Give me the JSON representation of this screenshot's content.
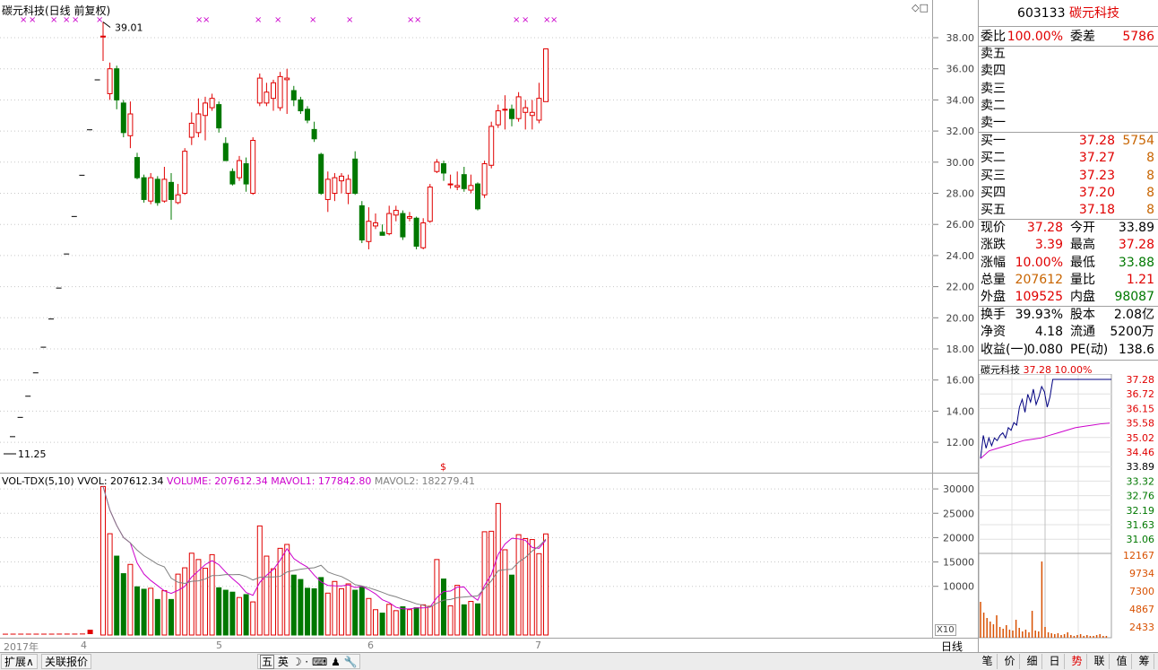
{
  "chart": {
    "title": "碳元科技(日线 前复权)"
  },
  "price_axis": [
    "38.00",
    "36.00",
    "34.00",
    "32.00",
    "30.00",
    "28.00",
    "26.00",
    "24.00",
    "22.00",
    "20.00",
    "18.00",
    "16.00",
    "14.00",
    "12.00"
  ],
  "price_annotations": {
    "high": "39.01",
    "low": "11.25"
  },
  "volume": {
    "indicator": "VOL-TDX(5,10)",
    "vvol": "VVOL: 207612.34",
    "volume": "VOLUME: 207612.34",
    "mavol1": "MAVOL1: 177842.80",
    "mavol2": "MAVOL2: 182279.41",
    "scale_label": "X10",
    "axis": [
      "30000",
      "25000",
      "20000",
      "15000",
      "10000"
    ]
  },
  "time_axis": [
    "2017年",
    "4",
    "5",
    "6",
    "7",
    "日线"
  ],
  "quote": {
    "code": "603133",
    "name": "碳元科技",
    "entrust": [
      "委比",
      "100.00%",
      "委差",
      "5786"
    ],
    "asks": [
      {
        "label": "卖五",
        "price": "",
        "vol": ""
      },
      {
        "label": "卖四",
        "price": "",
        "vol": ""
      },
      {
        "label": "卖三",
        "price": "",
        "vol": ""
      },
      {
        "label": "卖二",
        "price": "",
        "vol": ""
      },
      {
        "label": "卖一",
        "price": "",
        "vol": ""
      }
    ],
    "bids": [
      {
        "label": "买一",
        "price": "37.28",
        "vol": "5754"
      },
      {
        "label": "买二",
        "price": "37.27",
        "vol": "8"
      },
      {
        "label": "买三",
        "price": "37.23",
        "vol": "8"
      },
      {
        "label": "买四",
        "price": "37.20",
        "vol": "8"
      },
      {
        "label": "买五",
        "price": "37.18",
        "vol": "8"
      }
    ],
    "stats1": [
      {
        "k": "现价",
        "v": "37.28",
        "vc": "red",
        "k2": "今开",
        "v2": "33.89",
        "v2c": "blk"
      },
      {
        "k": "涨跌",
        "v": "3.39",
        "vc": "red",
        "k2": "最高",
        "v2": "37.28",
        "v2c": "red"
      },
      {
        "k": "涨幅",
        "v": "10.00%",
        "vc": "red",
        "k2": "最低",
        "v2": "33.88",
        "v2c": "green"
      },
      {
        "k": "总量",
        "v": "207612",
        "vc": "orange",
        "k2": "量比",
        "v2": "1.21",
        "v2c": "red"
      },
      {
        "k": "外盘",
        "v": "109525",
        "vc": "red",
        "k2": "内盘",
        "v2": "98087",
        "v2c": "green"
      }
    ],
    "stats2": [
      {
        "k": "换手",
        "v": "39.93%",
        "vc": "blk",
        "k2": "股本",
        "v2": "2.08亿",
        "v2c": "blk"
      },
      {
        "k": "净资",
        "v": "4.18",
        "vc": "blk",
        "k2": "流通",
        "v2": "5200万",
        "v2c": "blk"
      },
      {
        "k": "收益(一)",
        "v": "0.080",
        "vc": "blk",
        "k2": "PE(动)",
        "v2": "138.6",
        "v2c": "blk"
      }
    ]
  },
  "mini": {
    "name": "碳元科技",
    "price": "37.28",
    "pct": "10.00%",
    "price_labels": [
      "37.28",
      "36.72",
      "36.15",
      "35.58",
      "35.02",
      "34.46",
      "33.89",
      "33.32",
      "32.76",
      "32.19",
      "31.63",
      "31.06"
    ],
    "vol_labels": [
      "12167",
      "9734",
      "7300",
      "4867",
      "2433"
    ]
  },
  "toolbar": {
    "expand": "扩展∧",
    "related": "关联报价",
    "ime_1": "五",
    "ime_2": "英"
  },
  "tabs": [
    "笔",
    "价",
    "细",
    "日",
    "势",
    "联",
    "值",
    "筹"
  ],
  "colors": {
    "up": "#e00000",
    "down": "#007800",
    "ma1": "#cc00cc",
    "ma2": "#808080",
    "mini_line": "#000080",
    "mini_avg": "#cc00cc",
    "mini_vol": "#d85000"
  },
  "chart_data": {
    "type": "candlestick",
    "price_range": [
      10.5,
      40.6
    ],
    "volume_range": [
      0,
      32000
    ],
    "limit_up_run": {
      "prices": [
        12.36,
        13.6,
        14.96,
        16.46,
        18.11,
        19.92,
        21.91,
        24.1,
        26.51,
        29.16,
        32.08,
        35.29
      ],
      "volumes": [
        80,
        90,
        90,
        90,
        90,
        90,
        90,
        100,
        100,
        100,
        120,
        900
      ]
    },
    "candles": [
      {
        "o": 38.1,
        "c": 38.1,
        "h": 39.01,
        "l": 36.5,
        "v": 30500
      },
      {
        "o": 34.4,
        "c": 36.0,
        "h": 36.4,
        "l": 34.0,
        "v": 20800
      },
      {
        "o": 36.0,
        "c": 34.0,
        "h": 36.2,
        "l": 33.4,
        "v": 16200
      },
      {
        "o": 33.8,
        "c": 31.9,
        "h": 34.0,
        "l": 31.6,
        "v": 12600
      },
      {
        "o": 31.7,
        "c": 33.1,
        "h": 33.9,
        "l": 30.9,
        "v": 14500
      },
      {
        "o": 30.3,
        "c": 29.0,
        "h": 30.6,
        "l": 28.9,
        "v": 9900
      },
      {
        "o": 29.0,
        "c": 27.6,
        "h": 29.2,
        "l": 27.4,
        "v": 9400
      },
      {
        "o": 27.5,
        "c": 29.0,
        "h": 29.3,
        "l": 27.3,
        "v": 9600
      },
      {
        "o": 28.9,
        "c": 27.4,
        "h": 29.1,
        "l": 27.2,
        "v": 7300
      },
      {
        "o": 27.5,
        "c": 28.9,
        "h": 29.7,
        "l": 27.4,
        "v": 9100
      },
      {
        "o": 28.7,
        "c": 27.6,
        "h": 29.3,
        "l": 26.3,
        "v": 7300
      },
      {
        "o": 27.4,
        "c": 27.9,
        "h": 28.6,
        "l": 27.3,
        "v": 12500
      },
      {
        "o": 28.0,
        "c": 30.7,
        "h": 30.9,
        "l": 27.9,
        "v": 13800
      },
      {
        "o": 31.6,
        "c": 32.5,
        "h": 33.2,
        "l": 31.1,
        "v": 16800
      },
      {
        "o": 31.9,
        "c": 33.1,
        "h": 34.1,
        "l": 31.6,
        "v": 15500
      },
      {
        "o": 33.0,
        "c": 33.8,
        "h": 34.2,
        "l": 31.4,
        "v": 13700
      },
      {
        "o": 33.5,
        "c": 34.1,
        "h": 34.4,
        "l": 33.3,
        "v": 16500
      },
      {
        "o": 33.7,
        "c": 32.2,
        "h": 33.9,
        "l": 31.9,
        "v": 9700
      },
      {
        "o": 31.2,
        "c": 30.1,
        "h": 31.6,
        "l": 30.1,
        "v": 9200
      },
      {
        "o": 29.4,
        "c": 28.6,
        "h": 29.6,
        "l": 28.5,
        "v": 8800
      },
      {
        "o": 29.0,
        "c": 30.1,
        "h": 30.4,
        "l": 28.8,
        "v": 7700
      },
      {
        "o": 29.9,
        "c": 28.6,
        "h": 30.3,
        "l": 28.1,
        "v": 8300
      },
      {
        "o": 28.0,
        "c": 31.4,
        "h": 31.6,
        "l": 27.9,
        "v": 6800
      },
      {
        "o": 33.8,
        "c": 35.4,
        "h": 35.7,
        "l": 33.6,
        "v": 22400
      },
      {
        "o": 33.8,
        "c": 34.5,
        "h": 35.1,
        "l": 33.6,
        "v": 16200
      },
      {
        "o": 34.1,
        "c": 35.1,
        "h": 35.3,
        "l": 33.3,
        "v": 13600
      },
      {
        "o": 33.5,
        "c": 35.5,
        "h": 35.8,
        "l": 33.3,
        "v": 17800
      },
      {
        "o": 35.3,
        "c": 35.4,
        "h": 36.0,
        "l": 33.1,
        "v": 18600
      },
      {
        "o": 34.6,
        "c": 34.0,
        "h": 34.9,
        "l": 33.6,
        "v": 12300
      },
      {
        "o": 34.0,
        "c": 33.3,
        "h": 34.2,
        "l": 33.1,
        "v": 11400
      },
      {
        "o": 33.4,
        "c": 32.7,
        "h": 33.6,
        "l": 32.5,
        "v": 9600
      },
      {
        "o": 32.1,
        "c": 31.5,
        "h": 32.6,
        "l": 31.3,
        "v": 9500
      },
      {
        "o": 30.5,
        "c": 28.0,
        "h": 30.6,
        "l": 27.9,
        "v": 11800
      },
      {
        "o": 27.6,
        "c": 28.9,
        "h": 29.4,
        "l": 26.8,
        "v": 8600
      },
      {
        "o": 28.0,
        "c": 29.0,
        "h": 29.3,
        "l": 27.5,
        "v": 11000
      },
      {
        "o": 28.8,
        "c": 29.1,
        "h": 29.3,
        "l": 28.0,
        "v": 9500
      },
      {
        "o": 28.0,
        "c": 28.9,
        "h": 29.2,
        "l": 27.3,
        "v": 10500
      },
      {
        "o": 30.2,
        "c": 28.0,
        "h": 30.7,
        "l": 27.9,
        "v": 9200
      },
      {
        "o": 27.2,
        "c": 25.0,
        "h": 27.5,
        "l": 24.8,
        "v": 9800
      },
      {
        "o": 24.9,
        "c": 26.2,
        "h": 27.1,
        "l": 24.4,
        "v": 7500
      },
      {
        "o": 25.9,
        "c": 26.1,
        "h": 26.7,
        "l": 25.7,
        "v": 5200
      },
      {
        "o": 25.5,
        "c": 25.3,
        "h": 26.0,
        "l": 25.3,
        "v": 4500
      },
      {
        "o": 25.4,
        "c": 26.7,
        "h": 27.2,
        "l": 25.3,
        "v": 6300
      },
      {
        "o": 26.6,
        "c": 26.9,
        "h": 27.2,
        "l": 26.2,
        "v": 5000
      },
      {
        "o": 26.7,
        "c": 25.2,
        "h": 26.9,
        "l": 25.0,
        "v": 5800
      },
      {
        "o": 26.4,
        "c": 26.5,
        "h": 26.8,
        "l": 26.2,
        "v": 5200
      },
      {
        "o": 26.4,
        "c": 24.6,
        "h": 26.5,
        "l": 24.4,
        "v": 5600
      },
      {
        "o": 24.5,
        "c": 26.1,
        "h": 26.4,
        "l": 24.4,
        "v": 6200
      },
      {
        "o": 26.2,
        "c": 28.4,
        "h": 28.6,
        "l": 26.1,
        "v": 5900
      },
      {
        "o": 29.4,
        "c": 30.0,
        "h": 30.2,
        "l": 29.3,
        "v": 15500
      },
      {
        "o": 29.9,
        "c": 29.3,
        "h": 30.1,
        "l": 28.8,
        "v": 11500
      },
      {
        "o": 28.6,
        "c": 28.6,
        "h": 29.2,
        "l": 28.3,
        "v": 6000
      },
      {
        "o": 28.4,
        "c": 28.5,
        "h": 29.4,
        "l": 28.2,
        "v": 10200
      },
      {
        "o": 29.2,
        "c": 28.3,
        "h": 29.7,
        "l": 28.1,
        "v": 6200
      },
      {
        "o": 28.2,
        "c": 28.5,
        "h": 29.2,
        "l": 28.0,
        "v": 6900
      },
      {
        "o": 28.6,
        "c": 27.0,
        "h": 28.7,
        "l": 26.9,
        "v": 6400
      },
      {
        "o": 27.9,
        "c": 29.9,
        "h": 30.1,
        "l": 27.7,
        "v": 21200
      },
      {
        "o": 29.8,
        "c": 32.3,
        "h": 32.6,
        "l": 29.6,
        "v": 21300
      },
      {
        "o": 32.4,
        "c": 33.3,
        "h": 33.7,
        "l": 32.2,
        "v": 27000
      },
      {
        "o": 33.4,
        "c": 33.4,
        "h": 34.3,
        "l": 32.1,
        "v": 17500
      },
      {
        "o": 33.4,
        "c": 32.8,
        "h": 33.7,
        "l": 32.3,
        "v": 12300
      },
      {
        "o": 32.8,
        "c": 34.2,
        "h": 34.5,
        "l": 32.6,
        "v": 20600
      },
      {
        "o": 33.2,
        "c": 33.5,
        "h": 34.0,
        "l": 32.1,
        "v": 19800
      },
      {
        "o": 33.0,
        "c": 33.2,
        "h": 34.0,
        "l": 32.1,
        "v": 19600
      },
      {
        "o": 32.7,
        "c": 34.1,
        "h": 35.1,
        "l": 32.5,
        "v": 16700
      },
      {
        "o": 33.89,
        "c": 37.28,
        "h": 37.28,
        "l": 33.88,
        "v": 20761
      }
    ]
  }
}
